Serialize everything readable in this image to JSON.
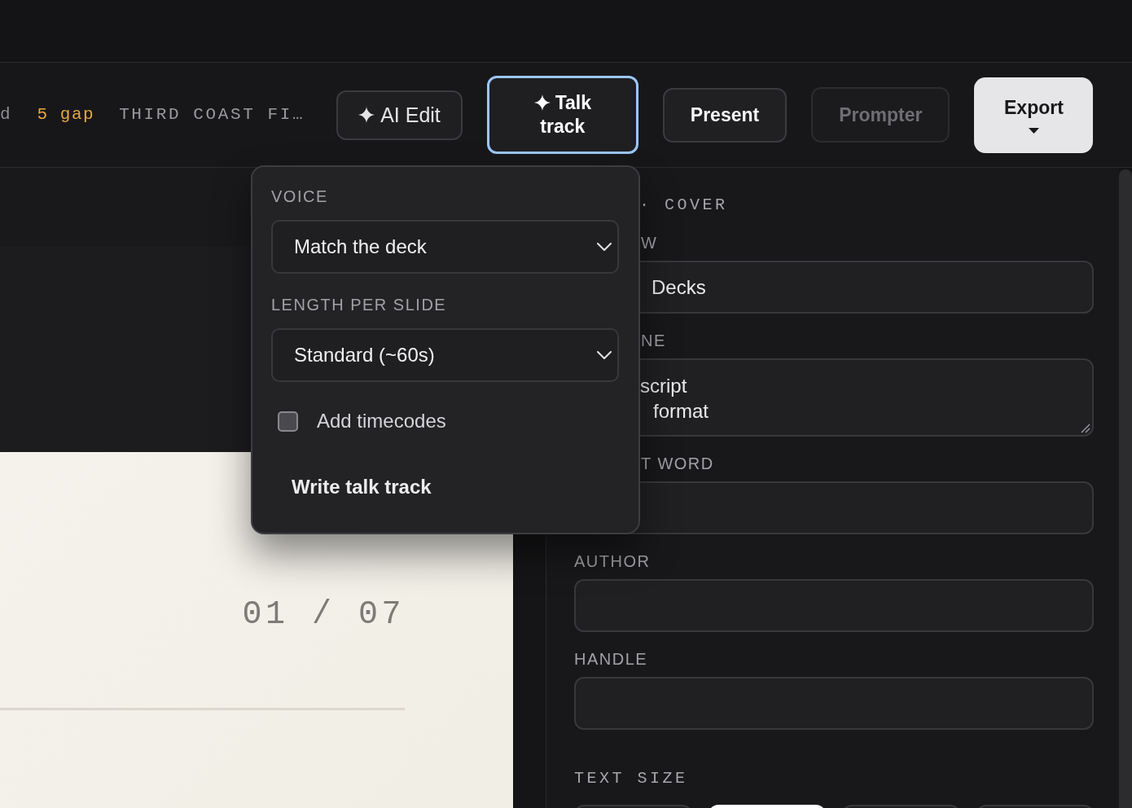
{
  "toolbar": {
    "deck_info": [
      {
        "kind": "meta",
        "text": "d"
      },
      {
        "kind": "accent",
        "text": "5 gap"
      },
      {
        "kind": "title",
        "text": "THIRD COAST FI…"
      }
    ],
    "buttons": [
      {
        "kind": "ai",
        "label": "AI Edit",
        "active": false,
        "disabled": false
      },
      {
        "kind": "ai",
        "label": "Talk track",
        "active": true,
        "disabled": false
      },
      {
        "kind": "plain",
        "label": "Present",
        "active": false,
        "disabled": false
      },
      {
        "kind": "plain",
        "label": "Prompter",
        "active": false,
        "disabled": true
      },
      {
        "kind": "menu",
        "label": "Export",
        "active": false,
        "disabled": false
      }
    ]
  },
  "popover": {
    "fields": [
      {
        "kind": "select",
        "label": "VOICE",
        "value": "Match the deck"
      },
      {
        "kind": "select",
        "label": "LENGTH PER SLIDE",
        "value": "Standard (~60s)"
      },
      {
        "kind": "checkbox",
        "label": "Add timecodes",
        "checked": false
      }
    ],
    "action": "Write talk track"
  },
  "slide": {
    "counter": "01 / 07"
  },
  "inspector": {
    "heading": "· COVER",
    "fields": [
      {
        "kind": "input",
        "label": "W",
        "value": "Decks"
      },
      {
        "kind": "textarea",
        "label": "NE",
        "value": "script\nformat"
      },
      {
        "kind": "input",
        "label": "T WORD"
      },
      {
        "kind": "input",
        "label": "AUTHOR"
      },
      {
        "kind": "input",
        "label": "HANDLE"
      }
    ],
    "text_size": {
      "label": "TEXT SIZE",
      "options": [
        {
          "selected": false
        },
        {
          "selected": true
        },
        {
          "selected": false
        },
        {
          "selected": false
        }
      ]
    }
  }
}
